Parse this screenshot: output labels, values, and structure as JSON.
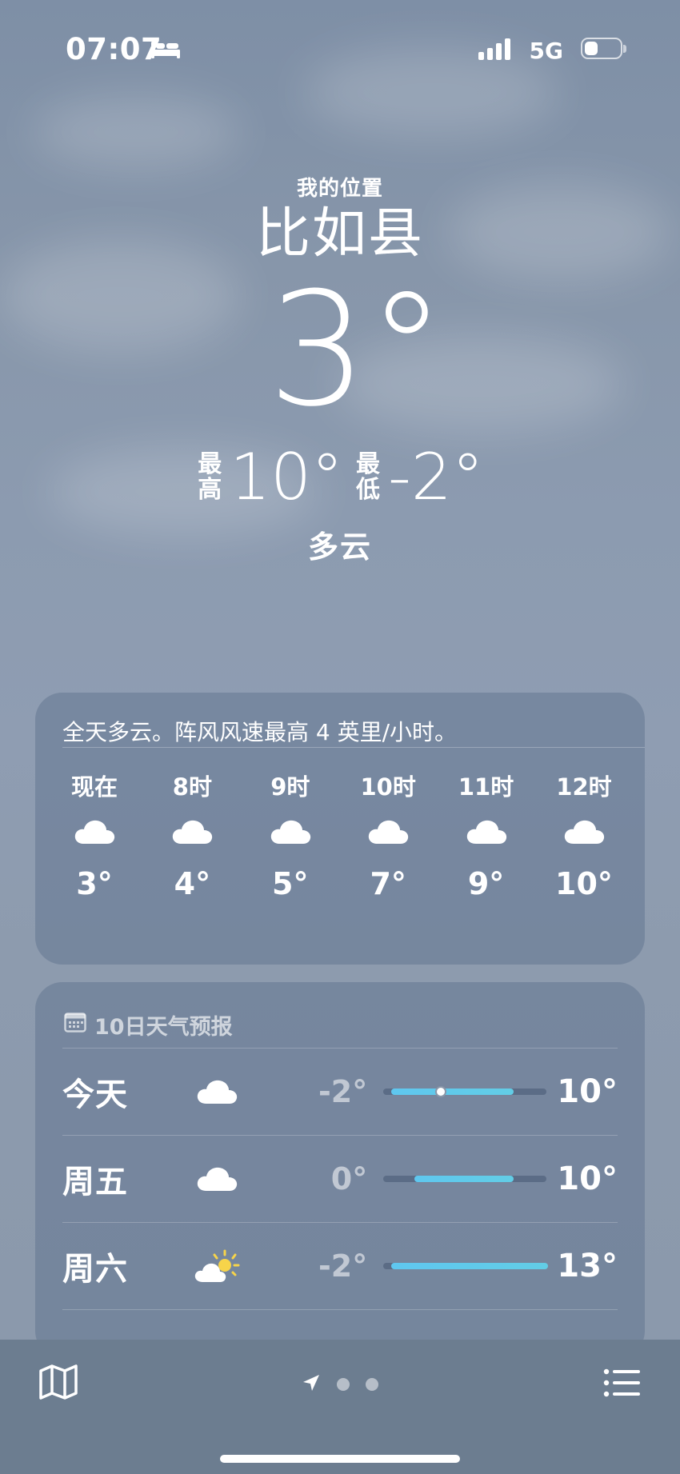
{
  "status_bar": {
    "time": "07:07",
    "network": "5G",
    "focus_icon": "bed-icon"
  },
  "current": {
    "location_label": "我的位置",
    "city": "比如县",
    "temperature": "3°",
    "high_tag": "最\n高",
    "high": "10°",
    "low_tag": "最\n低",
    "low": "-2°",
    "condition": "多云"
  },
  "hourly": {
    "summary": "全天多云。阵风风速最高 4 英里/小时。",
    "hours": [
      {
        "label": "现在",
        "icon": "cloud-icon",
        "temp": "3°"
      },
      {
        "label": "8时",
        "icon": "cloud-icon",
        "temp": "4°"
      },
      {
        "label": "9时",
        "icon": "cloud-icon",
        "temp": "5°"
      },
      {
        "label": "10时",
        "icon": "cloud-icon",
        "temp": "7°"
      },
      {
        "label": "11时",
        "icon": "cloud-icon",
        "temp": "9°"
      },
      {
        "label": "12时",
        "icon": "cloud-icon",
        "temp": "10°"
      }
    ]
  },
  "daily": {
    "title": "10日天气预报",
    "icon": "calendar-icon",
    "range_min": -2,
    "range_max": 13,
    "days": [
      {
        "day": "今天",
        "icon": "cloud-icon",
        "low": "-2°",
        "high": "10°",
        "low_value": -2,
        "high_value": 10,
        "current_value": 3
      },
      {
        "day": "周五",
        "icon": "cloud-icon",
        "low": "0°",
        "high": "10°",
        "low_value": 0,
        "high_value": 10
      },
      {
        "day": "周六",
        "icon": "partly-sunny-icon",
        "low": "-2°",
        "high": "13°",
        "low_value": -2,
        "high_value": 13
      }
    ]
  },
  "colors": {
    "range_bar": "#5fc7ef",
    "bottom_bar": "#6c7d90"
  }
}
